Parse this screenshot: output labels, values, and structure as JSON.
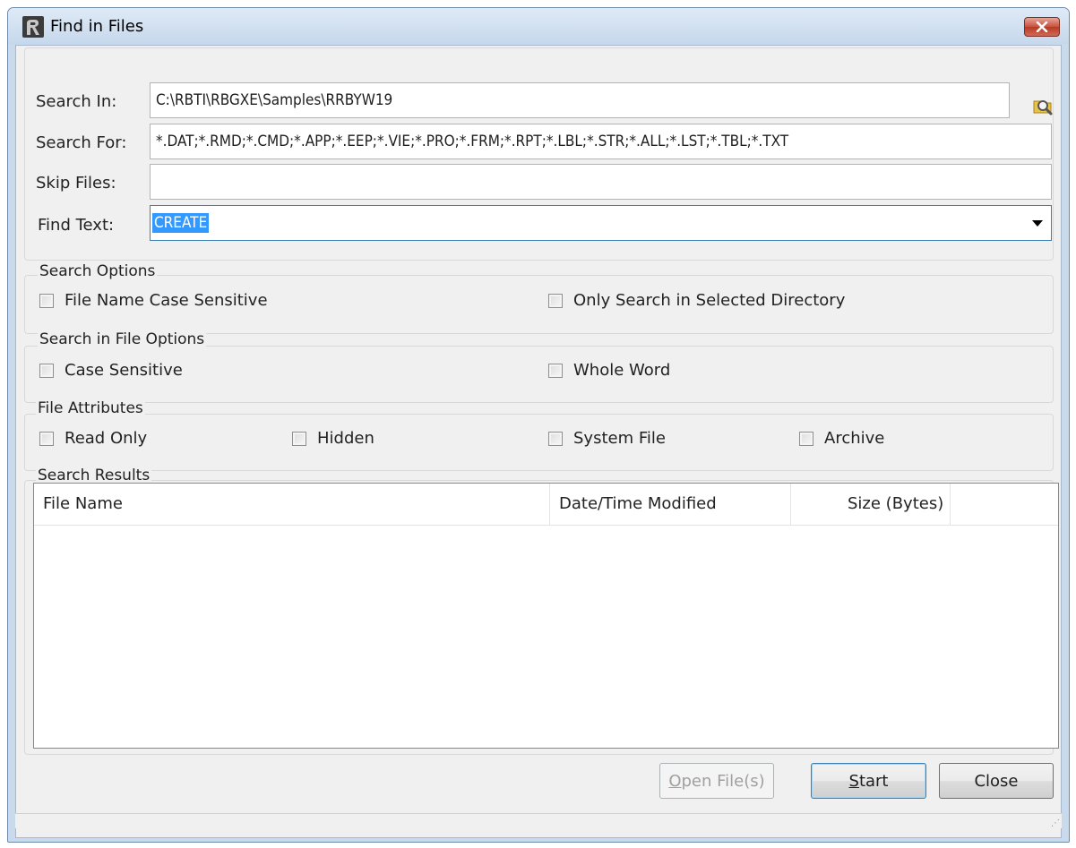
{
  "window": {
    "title": "Find in Files"
  },
  "fields": {
    "search_in": {
      "label": "Search In:",
      "value": "C:\\RBTI\\RBGXE\\Samples\\RRBYW19"
    },
    "search_for": {
      "label": "Search For:",
      "value": "*.DAT;*.RMD;*.CMD;*.APP;*.EEP;*.VIE;*.PRO;*.FRM;*.RPT;*.LBL;*.STR;*.ALL;*.LST;*.TBL;*.TXT"
    },
    "skip_files": {
      "label": "Skip Files:",
      "value": ""
    },
    "find_text": {
      "label": "Find Text:",
      "value": "CREATE"
    }
  },
  "search_options": {
    "title": "Search Options",
    "file_name_case_sensitive": {
      "label": "File Name Case Sensitive",
      "checked": false
    },
    "only_selected_directory": {
      "label": "Only Search in Selected Directory",
      "checked": false
    }
  },
  "file_options": {
    "title": "Search in File Options",
    "case_sensitive": {
      "label": "Case Sensitive",
      "checked": false
    },
    "whole_word": {
      "label": "Whole Word",
      "checked": false
    }
  },
  "file_attributes": {
    "title": "File Attributes",
    "read_only": {
      "label": "Read Only",
      "checked": false
    },
    "hidden": {
      "label": "Hidden",
      "checked": false
    },
    "system_file": {
      "label": "System File",
      "checked": false
    },
    "archive": {
      "label": "Archive",
      "checked": false
    }
  },
  "results": {
    "title": "Search Results",
    "columns": [
      "File Name",
      "Date/Time Modified",
      "Size (Bytes)"
    ],
    "rows": []
  },
  "buttons": {
    "open_files": {
      "label_mnemonic": "O",
      "label_rest": "pen File(s)",
      "enabled": false
    },
    "start": {
      "label_mnemonic": "S",
      "label_rest": "tart",
      "enabled": true
    },
    "close": {
      "label": "Close",
      "enabled": true
    }
  },
  "colors": {
    "selection": "#3399ff",
    "title_bar": "#c9daed",
    "close_button": "#c9513d",
    "dialog_background": "#f0f0f0"
  }
}
